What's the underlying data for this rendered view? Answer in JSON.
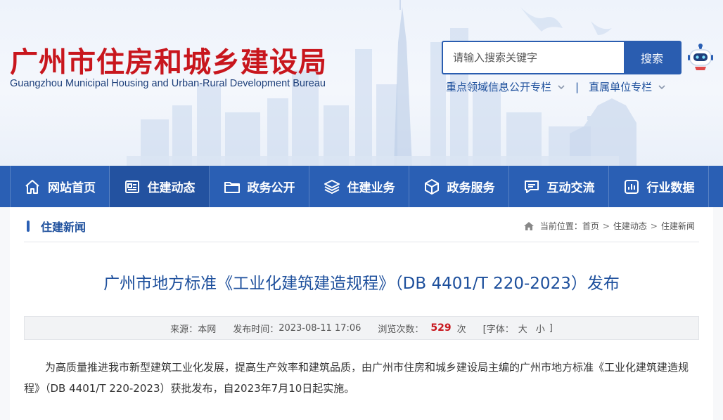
{
  "header": {
    "title": "广州市住房和城乡建设局",
    "subtitle": "Guangzhou Municipal Housing and Urban-Rural Development Bureau",
    "search": {
      "placeholder": "请输入搜索关键字",
      "button_label": "搜索"
    },
    "quick_links": [
      {
        "label": "重点领域信息公开专栏",
        "icon": "chevron-down-icon"
      },
      {
        "label": "直属单位专栏",
        "icon": "chevron-down-icon"
      }
    ],
    "quick_links_separator": "|",
    "assistant_icon": "robot-icon"
  },
  "nav": {
    "items": [
      {
        "label": "网站首页",
        "icon": "home-icon",
        "active": false
      },
      {
        "label": "住建动态",
        "icon": "news-icon",
        "active": true
      },
      {
        "label": "政务公开",
        "icon": "folder-icon",
        "active": false
      },
      {
        "label": "住建业务",
        "icon": "layers-icon",
        "active": false
      },
      {
        "label": "政务服务",
        "icon": "cube-icon",
        "active": false
      },
      {
        "label": "互动交流",
        "icon": "chat-icon",
        "active": false
      },
      {
        "label": "行业数据",
        "icon": "chart-icon",
        "active": false
      }
    ]
  },
  "section": {
    "title": "住建新闻",
    "breadcrumb": {
      "prefix": "当前位置：",
      "items": [
        "首页",
        "住建动态",
        "住建新闻"
      ],
      "separator": ">"
    }
  },
  "article": {
    "title": "广州市地方标准《工业化建筑建造规程》（DB 4401/T 220-2023）发布",
    "meta": {
      "source_label": "来源：",
      "source": "本网",
      "time_label": "发布时间：",
      "time": "2023-08-11 17:06",
      "views_label": "浏览次数：",
      "views": "529",
      "views_unit": "次",
      "font_label": "[字体：",
      "font_large": "大",
      "font_small": "小",
      "font_close": "]"
    },
    "body": "为高质量推进我市新型建筑工业化发展，提高生产效率和建筑品质，由广州市住房和城乡建设局主编的广州市地方标准《工业化建筑建造规程》（DB 4401/T 220-2023）获批发布，自2023年7月10日起实施。"
  },
  "colors": {
    "brand_red": "#c8161d",
    "primary_blue": "#2a5fb4",
    "active_nav": "#2352a0",
    "link_blue": "#1d4f9c"
  }
}
